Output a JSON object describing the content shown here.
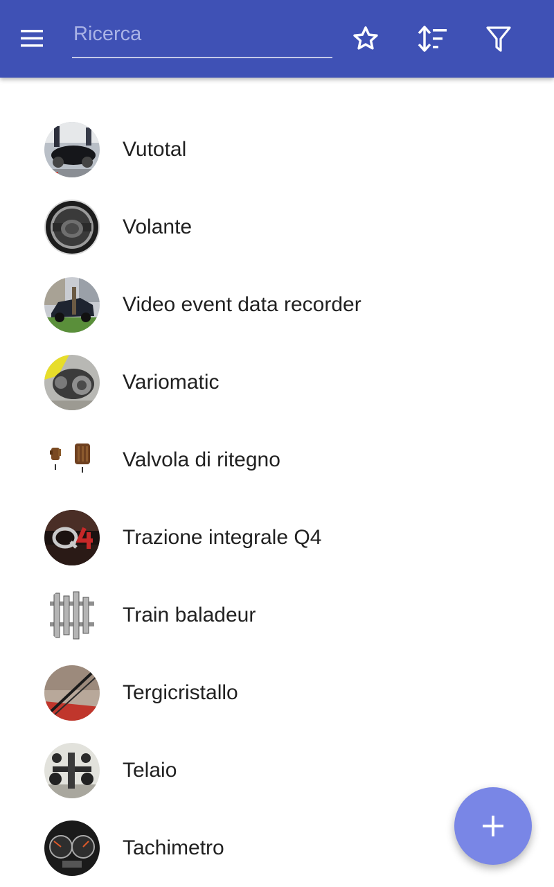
{
  "header": {
    "search_placeholder": "Ricerca",
    "colors": {
      "app_bar": "#3f51b5",
      "fab": "#7986e6"
    },
    "icons": [
      "menu-icon",
      "star-icon",
      "sort-icon",
      "filter-icon"
    ]
  },
  "items": [
    {
      "label": "Vutotal",
      "thumb": "vintage-car"
    },
    {
      "label": "Volante",
      "thumb": "steering-wheel"
    },
    {
      "label": "Video event data recorder",
      "thumb": "crashed-car"
    },
    {
      "label": "Variomatic",
      "thumb": "belt-transmission"
    },
    {
      "label": "Valvola di ritegno",
      "thumb": "check-valve"
    },
    {
      "label": "Trazione integrale Q4",
      "thumb": "q4-badge"
    },
    {
      "label": "Train baladeur",
      "thumb": "gearbox-diagram"
    },
    {
      "label": "Tergicristallo",
      "thumb": "windshield-wiper"
    },
    {
      "label": "Telaio",
      "thumb": "car-chassis"
    },
    {
      "label": "Tachimetro",
      "thumb": "speedometer"
    }
  ],
  "fab": {
    "icon": "plus-icon"
  }
}
